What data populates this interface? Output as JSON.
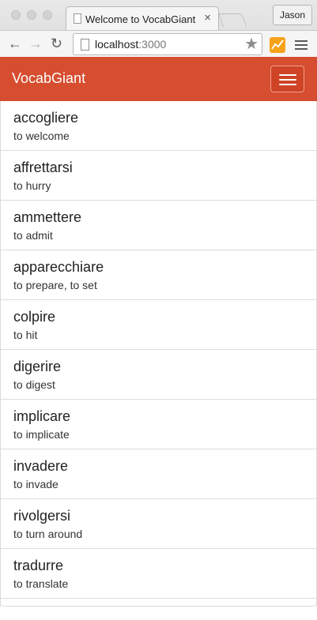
{
  "browser": {
    "tab_title": "Welcome to VocabGiant",
    "tab_close": "×",
    "profile_name": "Jason",
    "url_host": "localhost",
    "url_port": ":3000",
    "icons": {
      "back": "arrow-left-icon",
      "forward": "arrow-right-icon",
      "reload": "reload-icon",
      "star": "star-icon",
      "extension": "chart-extension-icon",
      "menu": "hamburger-menu-icon"
    }
  },
  "app": {
    "brand": "VocabGiant",
    "brand_color": "#d64d2f",
    "words": [
      {
        "word": "accogliere",
        "meaning": "to welcome"
      },
      {
        "word": "affrettarsi",
        "meaning": "to hurry"
      },
      {
        "word": "ammettere",
        "meaning": "to admit"
      },
      {
        "word": "apparecchiare",
        "meaning": "to prepare, to set"
      },
      {
        "word": "colpire",
        "meaning": "to hit"
      },
      {
        "word": "digerire",
        "meaning": "to digest"
      },
      {
        "word": "implicare",
        "meaning": "to implicate"
      },
      {
        "word": "invadere",
        "meaning": "to invade"
      },
      {
        "word": "rivolgersi",
        "meaning": "to turn around"
      },
      {
        "word": "tradurre",
        "meaning": "to translate"
      }
    ]
  }
}
